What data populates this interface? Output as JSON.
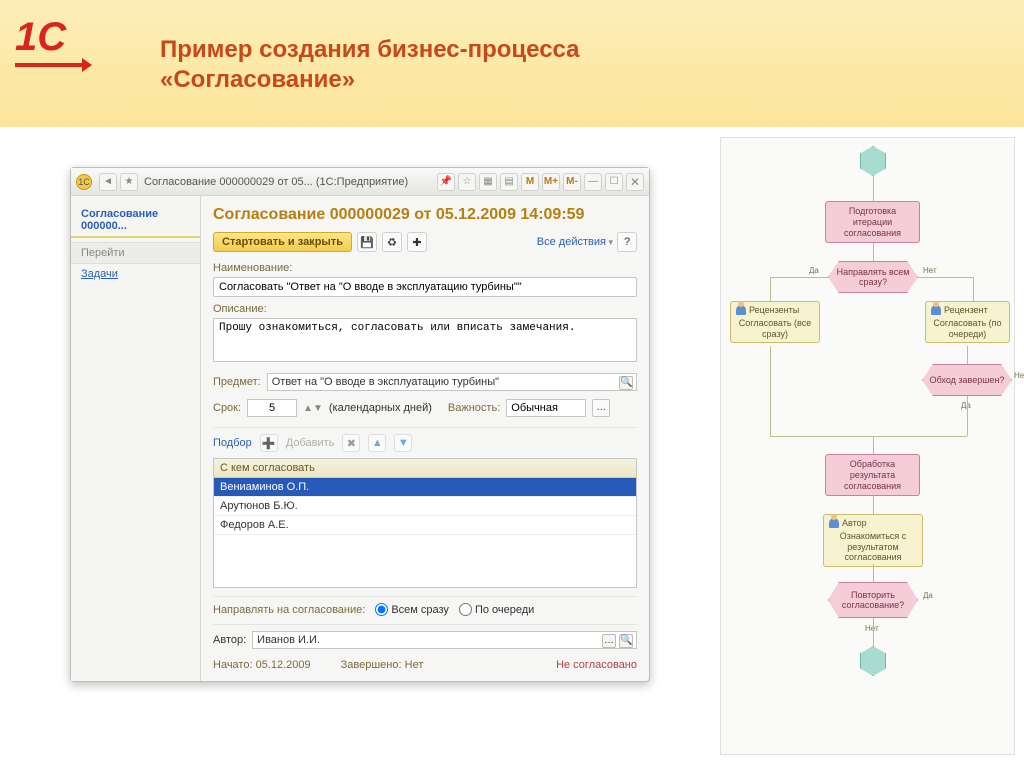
{
  "slide": {
    "title_l1": "Пример создания бизнес-процесса",
    "title_l2": "«Согласование»"
  },
  "titlebar": {
    "text": "Согласование 000000029 от 05...  (1С:Предприятие)",
    "m": "M",
    "mp": "M+",
    "mm": "M-"
  },
  "sidebar": {
    "tab": "Согласование 000000...",
    "nav_header": "Перейти",
    "link_tasks": "Задачи"
  },
  "form": {
    "title": "Согласование 000000029 от 05.12.2009 14:09:59",
    "btn_start_close": "Стартовать и закрыть",
    "all_actions": "Все действия",
    "lbl_name": "Наименование:",
    "val_name": "Согласовать \"Ответ на \"О вводе в эксплуатацию турбины\"\"",
    "lbl_descr": "Описание:",
    "val_descr": "Прошу ознакомиться, согласовать или вписать замечания.",
    "lbl_subject": "Предмет:",
    "val_subject": "Ответ на \"О вводе в эксплуатацию турбины\"",
    "lbl_term": "Срок:",
    "val_term": "5",
    "term_unit": "(календарных дней)",
    "lbl_priority": "Важность:",
    "val_priority": "Обычная",
    "link_select": "Подбор",
    "link_add": "Добавить",
    "th_approver": "С кем согласовать",
    "rows": [
      "Вениаминов О.П.",
      "Арутюнов Б.Ю.",
      "Федоров А.Е."
    ],
    "lbl_sendmode": "Направлять на согласование:",
    "radio_all": "Всем сразу",
    "radio_seq": "По очереди",
    "lbl_author": "Автор:",
    "val_author": "Иванов И.И.",
    "lbl_started": "Начато:",
    "val_started": "05.12.2009",
    "lbl_finished": "Завершено:",
    "val_finished": "Нет",
    "status": "Не согласовано"
  },
  "flow": {
    "n_prepare": "Подготовка итерации согласования",
    "d_sendall": "Направлять всем сразу?",
    "yes": "Да",
    "no": "Нет",
    "t_reviewers_role": "Рецензенты",
    "t_reviewers_act": "Согласовать (все сразу)",
    "t_reviewer_role": "Рецензент",
    "t_reviewer_act": "Согласовать (по очереди)",
    "d_done": "Обход завершен?",
    "n_process": "Обработка результата согласования",
    "t_author_role": "Автор",
    "t_author_act": "Ознакомиться с результатом согласования",
    "d_repeat": "Повторить согласование?"
  }
}
